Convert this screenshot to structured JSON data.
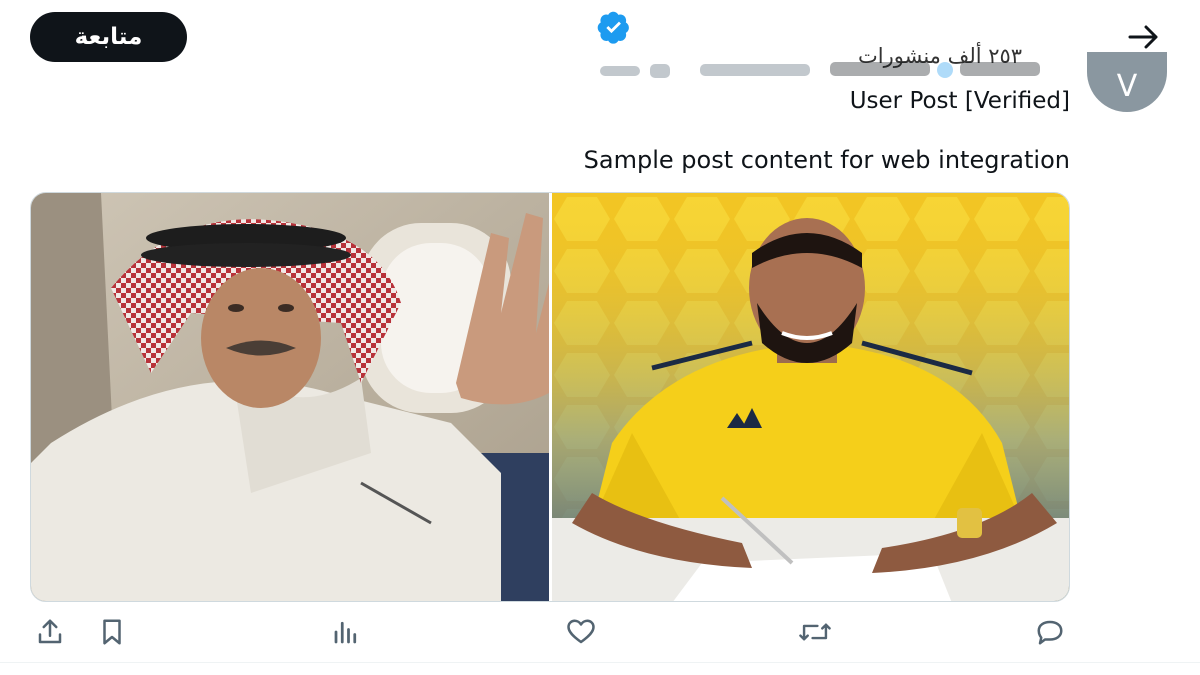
{
  "header": {
    "follow_label": "متابعة",
    "posts_count": "٢٥٣ ألف منشورات",
    "back_icon": "arrow-right-icon",
    "verified_icon": "verified-badge-icon"
  },
  "post": {
    "author_handle": "User Post [Verified]",
    "content": "Sample post content for web integration",
    "avatar_letter": "V"
  },
  "media": {
    "images": [
      {
        "name": "photo-man-in-ghutra-on-plane"
      },
      {
        "name": "photo-footballer-signing-contract"
      }
    ]
  },
  "actions": {
    "share_icon": "share-icon",
    "bookmark_icon": "bookmark-icon",
    "views_icon": "views-chart-icon",
    "like_icon": "heart-icon",
    "retweet_icon": "retweet-icon",
    "reply_icon": "reply-icon"
  },
  "colors": {
    "accent": "#1d9bf0",
    "button_bg": "#0f1419",
    "jersey_yellow": "#f5cf1a"
  }
}
